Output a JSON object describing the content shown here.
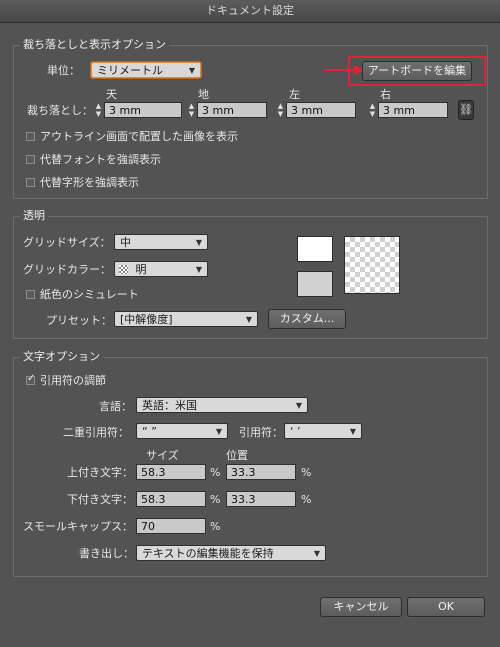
{
  "window": {
    "title": "ドキュメント設定"
  },
  "bleed_section": {
    "title": "裁ち落としと表示オプション",
    "unit_label": "単位：",
    "unit_value": "ミリメートル",
    "edit_artboards_button": "アートボードを編集",
    "bleed_label": "裁ち落とし：",
    "headers": {
      "top": "天",
      "bottom": "地",
      "left": "左",
      "right": "右"
    },
    "values": {
      "top": "3 mm",
      "bottom": "3 mm",
      "left": "3 mm",
      "right": "3 mm"
    },
    "options": [
      {
        "label": "アウトライン画面で配置した画像を表示",
        "checked": false
      },
      {
        "label": "代替フォントを強調表示",
        "checked": false
      },
      {
        "label": "代替字形を強調表示",
        "checked": false
      }
    ]
  },
  "transparency_section": {
    "title": "透明",
    "grid_size_label": "グリッドサイズ：",
    "grid_size_value": "中",
    "grid_color_label": "グリッドカラー：",
    "grid_color_value": "明",
    "simulate_paper": {
      "label": "紙色のシミュレート",
      "checked": false
    },
    "preset_label": "プリセット：",
    "preset_value": "[中解像度]",
    "custom_button": "カスタム..."
  },
  "type_section": {
    "title": "文字オプション",
    "smart_quotes": {
      "label": "引用符の調節",
      "checked": true
    },
    "language_label": "言語：",
    "language_value": "英語：米国",
    "double_quotes_label": "二重引用符：",
    "double_quotes_value": "“ ”",
    "single_quotes_label": "引用符：",
    "single_quotes_value": "‘ ’",
    "size_header": "サイズ",
    "position_header": "位置",
    "superscript_label": "上付き文字：",
    "superscript_size": "58.3",
    "superscript_position": "33.3",
    "subscript_label": "下付き文字：",
    "subscript_size": "58.3",
    "subscript_position": "33.3",
    "small_caps_label": "スモールキャップス：",
    "small_caps_value": "70",
    "percent": "%",
    "export_label": "書き出し：",
    "export_value": "テキストの編集機能を保持"
  },
  "footer": {
    "cancel_button": "キャンセル",
    "ok_button": "OK"
  },
  "colors": {
    "highlight": "#e0223a",
    "focus": "#d98a3a",
    "background": "#535353"
  }
}
